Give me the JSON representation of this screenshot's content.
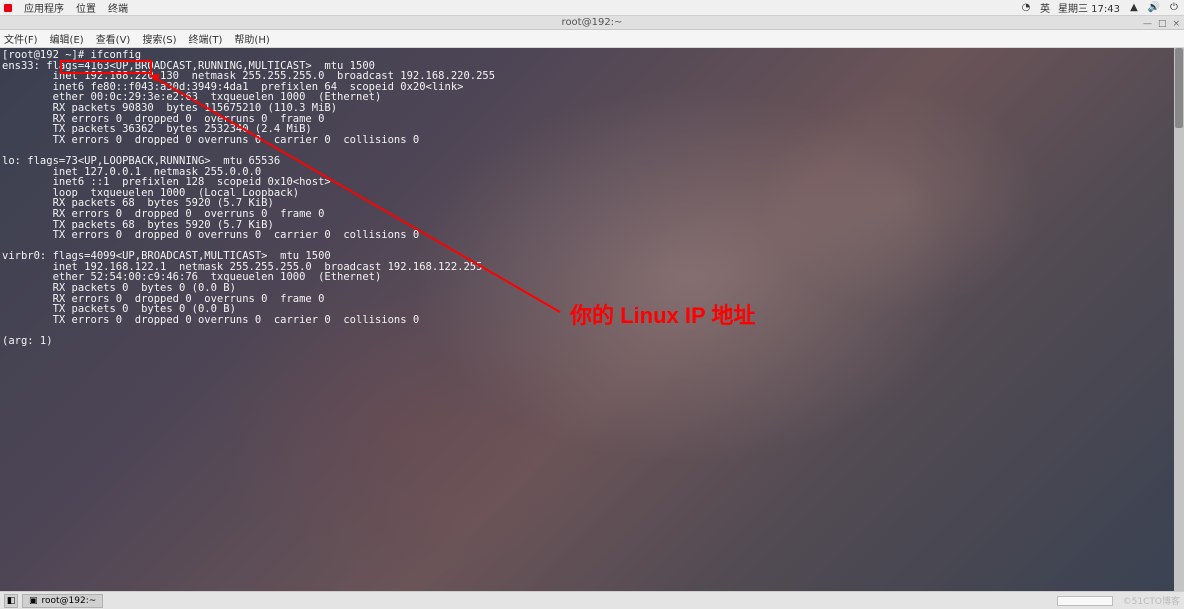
{
  "panel": {
    "app_menu": "应用程序",
    "places": "位置",
    "terminal": "终端",
    "input_method": "英",
    "datetime": "星期三 17:43",
    "icons": {
      "sys1": "◔",
      "network": "▲",
      "speaker": "🔊",
      "power": "⏻"
    }
  },
  "window": {
    "title": "root@192:~",
    "min": "—",
    "max": "□",
    "close": "×"
  },
  "menubar": {
    "file": "文件(F)",
    "edit": "编辑(E)",
    "view": "查看(V)",
    "search": "搜索(S)",
    "terminal": "终端(T)",
    "help": "帮助(H)"
  },
  "terminal": {
    "prompt": "[root@192 ~]# ifconfig",
    "ip_highlight": "192.168.220.130",
    "output_lines": [
      "ens33: flags=4163<UP,BROADCAST,RUNNING,MULTICAST>  mtu 1500",
      "        inet 192.168.220.130  netmask 255.255.255.0  broadcast 192.168.220.255",
      "        inet6 fe80::f043:a30d:3949:4da1  prefixlen 64  scopeid 0x20<link>",
      "        ether 00:0c:29:3e:e2:63  txqueuelen 1000  (Ethernet)",
      "        RX packets 90830  bytes 115675210 (110.3 MiB)",
      "        RX errors 0  dropped 0  overruns 0  frame 0",
      "        TX packets 36362  bytes 2532340 (2.4 MiB)",
      "        TX errors 0  dropped 0 overruns 0  carrier 0  collisions 0",
      "",
      "lo: flags=73<UP,LOOPBACK,RUNNING>  mtu 65536",
      "        inet 127.0.0.1  netmask 255.0.0.0",
      "        inet6 ::1  prefixlen 128  scopeid 0x10<host>",
      "        loop  txqueuelen 1000  (Local Loopback)",
      "        RX packets 68  bytes 5920 (5.7 KiB)",
      "        RX errors 0  dropped 0  overruns 0  frame 0",
      "        TX packets 68  bytes 5920 (5.7 KiB)",
      "        TX errors 0  dropped 0 overruns 0  carrier 0  collisions 0",
      "",
      "virbr0: flags=4099<UP,BROADCAST,MULTICAST>  mtu 1500",
      "        inet 192.168.122.1  netmask 255.255.255.0  broadcast 192.168.122.255",
      "        ether 52:54:00:c9:46:76  txqueuelen 1000  (Ethernet)",
      "        RX packets 0  bytes 0 (0.0 B)",
      "        RX errors 0  dropped 0  overruns 0  frame 0",
      "        TX packets 0  bytes 0 (0.0 B)",
      "        TX errors 0  dropped 0 overruns 0  carrier 0  collisions 0",
      "",
      "(arg: 1)"
    ]
  },
  "annotation": {
    "text": "你的 Linux IP 地址"
  },
  "taskbar": {
    "active_window": "root@192:~",
    "watermark": "©51CTO博客"
  }
}
